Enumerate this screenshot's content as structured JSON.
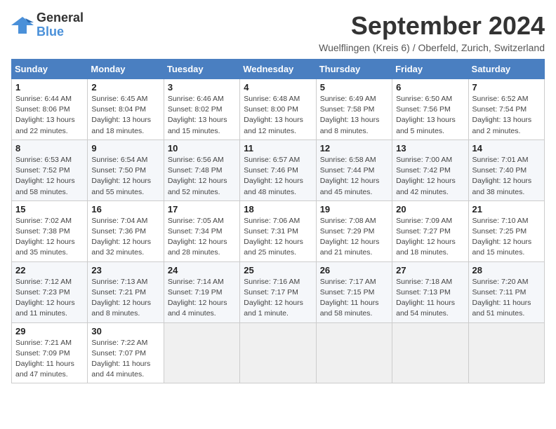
{
  "logo": {
    "line1": "General",
    "line2": "Blue"
  },
  "title": "September 2024",
  "subtitle": "Wuelflingen (Kreis 6) / Oberfeld, Zurich, Switzerland",
  "days_of_week": [
    "Sunday",
    "Monday",
    "Tuesday",
    "Wednesday",
    "Thursday",
    "Friday",
    "Saturday"
  ],
  "weeks": [
    [
      {
        "day": "1",
        "info": "Sunrise: 6:44 AM\nSunset: 8:06 PM\nDaylight: 13 hours\nand 22 minutes."
      },
      {
        "day": "2",
        "info": "Sunrise: 6:45 AM\nSunset: 8:04 PM\nDaylight: 13 hours\nand 18 minutes."
      },
      {
        "day": "3",
        "info": "Sunrise: 6:46 AM\nSunset: 8:02 PM\nDaylight: 13 hours\nand 15 minutes."
      },
      {
        "day": "4",
        "info": "Sunrise: 6:48 AM\nSunset: 8:00 PM\nDaylight: 13 hours\nand 12 minutes."
      },
      {
        "day": "5",
        "info": "Sunrise: 6:49 AM\nSunset: 7:58 PM\nDaylight: 13 hours\nand 8 minutes."
      },
      {
        "day": "6",
        "info": "Sunrise: 6:50 AM\nSunset: 7:56 PM\nDaylight: 13 hours\nand 5 minutes."
      },
      {
        "day": "7",
        "info": "Sunrise: 6:52 AM\nSunset: 7:54 PM\nDaylight: 13 hours\nand 2 minutes."
      }
    ],
    [
      {
        "day": "8",
        "info": "Sunrise: 6:53 AM\nSunset: 7:52 PM\nDaylight: 12 hours\nand 58 minutes."
      },
      {
        "day": "9",
        "info": "Sunrise: 6:54 AM\nSunset: 7:50 PM\nDaylight: 12 hours\nand 55 minutes."
      },
      {
        "day": "10",
        "info": "Sunrise: 6:56 AM\nSunset: 7:48 PM\nDaylight: 12 hours\nand 52 minutes."
      },
      {
        "day": "11",
        "info": "Sunrise: 6:57 AM\nSunset: 7:46 PM\nDaylight: 12 hours\nand 48 minutes."
      },
      {
        "day": "12",
        "info": "Sunrise: 6:58 AM\nSunset: 7:44 PM\nDaylight: 12 hours\nand 45 minutes."
      },
      {
        "day": "13",
        "info": "Sunrise: 7:00 AM\nSunset: 7:42 PM\nDaylight: 12 hours\nand 42 minutes."
      },
      {
        "day": "14",
        "info": "Sunrise: 7:01 AM\nSunset: 7:40 PM\nDaylight: 12 hours\nand 38 minutes."
      }
    ],
    [
      {
        "day": "15",
        "info": "Sunrise: 7:02 AM\nSunset: 7:38 PM\nDaylight: 12 hours\nand 35 minutes."
      },
      {
        "day": "16",
        "info": "Sunrise: 7:04 AM\nSunset: 7:36 PM\nDaylight: 12 hours\nand 32 minutes."
      },
      {
        "day": "17",
        "info": "Sunrise: 7:05 AM\nSunset: 7:34 PM\nDaylight: 12 hours\nand 28 minutes."
      },
      {
        "day": "18",
        "info": "Sunrise: 7:06 AM\nSunset: 7:31 PM\nDaylight: 12 hours\nand 25 minutes."
      },
      {
        "day": "19",
        "info": "Sunrise: 7:08 AM\nSunset: 7:29 PM\nDaylight: 12 hours\nand 21 minutes."
      },
      {
        "day": "20",
        "info": "Sunrise: 7:09 AM\nSunset: 7:27 PM\nDaylight: 12 hours\nand 18 minutes."
      },
      {
        "day": "21",
        "info": "Sunrise: 7:10 AM\nSunset: 7:25 PM\nDaylight: 12 hours\nand 15 minutes."
      }
    ],
    [
      {
        "day": "22",
        "info": "Sunrise: 7:12 AM\nSunset: 7:23 PM\nDaylight: 12 hours\nand 11 minutes."
      },
      {
        "day": "23",
        "info": "Sunrise: 7:13 AM\nSunset: 7:21 PM\nDaylight: 12 hours\nand 8 minutes."
      },
      {
        "day": "24",
        "info": "Sunrise: 7:14 AM\nSunset: 7:19 PM\nDaylight: 12 hours\nand 4 minutes."
      },
      {
        "day": "25",
        "info": "Sunrise: 7:16 AM\nSunset: 7:17 PM\nDaylight: 12 hours\nand 1 minute."
      },
      {
        "day": "26",
        "info": "Sunrise: 7:17 AM\nSunset: 7:15 PM\nDaylight: 11 hours\nand 58 minutes."
      },
      {
        "day": "27",
        "info": "Sunrise: 7:18 AM\nSunset: 7:13 PM\nDaylight: 11 hours\nand 54 minutes."
      },
      {
        "day": "28",
        "info": "Sunrise: 7:20 AM\nSunset: 7:11 PM\nDaylight: 11 hours\nand 51 minutes."
      }
    ],
    [
      {
        "day": "29",
        "info": "Sunrise: 7:21 AM\nSunset: 7:09 PM\nDaylight: 11 hours\nand 47 minutes."
      },
      {
        "day": "30",
        "info": "Sunrise: 7:22 AM\nSunset: 7:07 PM\nDaylight: 11 hours\nand 44 minutes."
      },
      {
        "day": "",
        "info": ""
      },
      {
        "day": "",
        "info": ""
      },
      {
        "day": "",
        "info": ""
      },
      {
        "day": "",
        "info": ""
      },
      {
        "day": "",
        "info": ""
      }
    ]
  ]
}
